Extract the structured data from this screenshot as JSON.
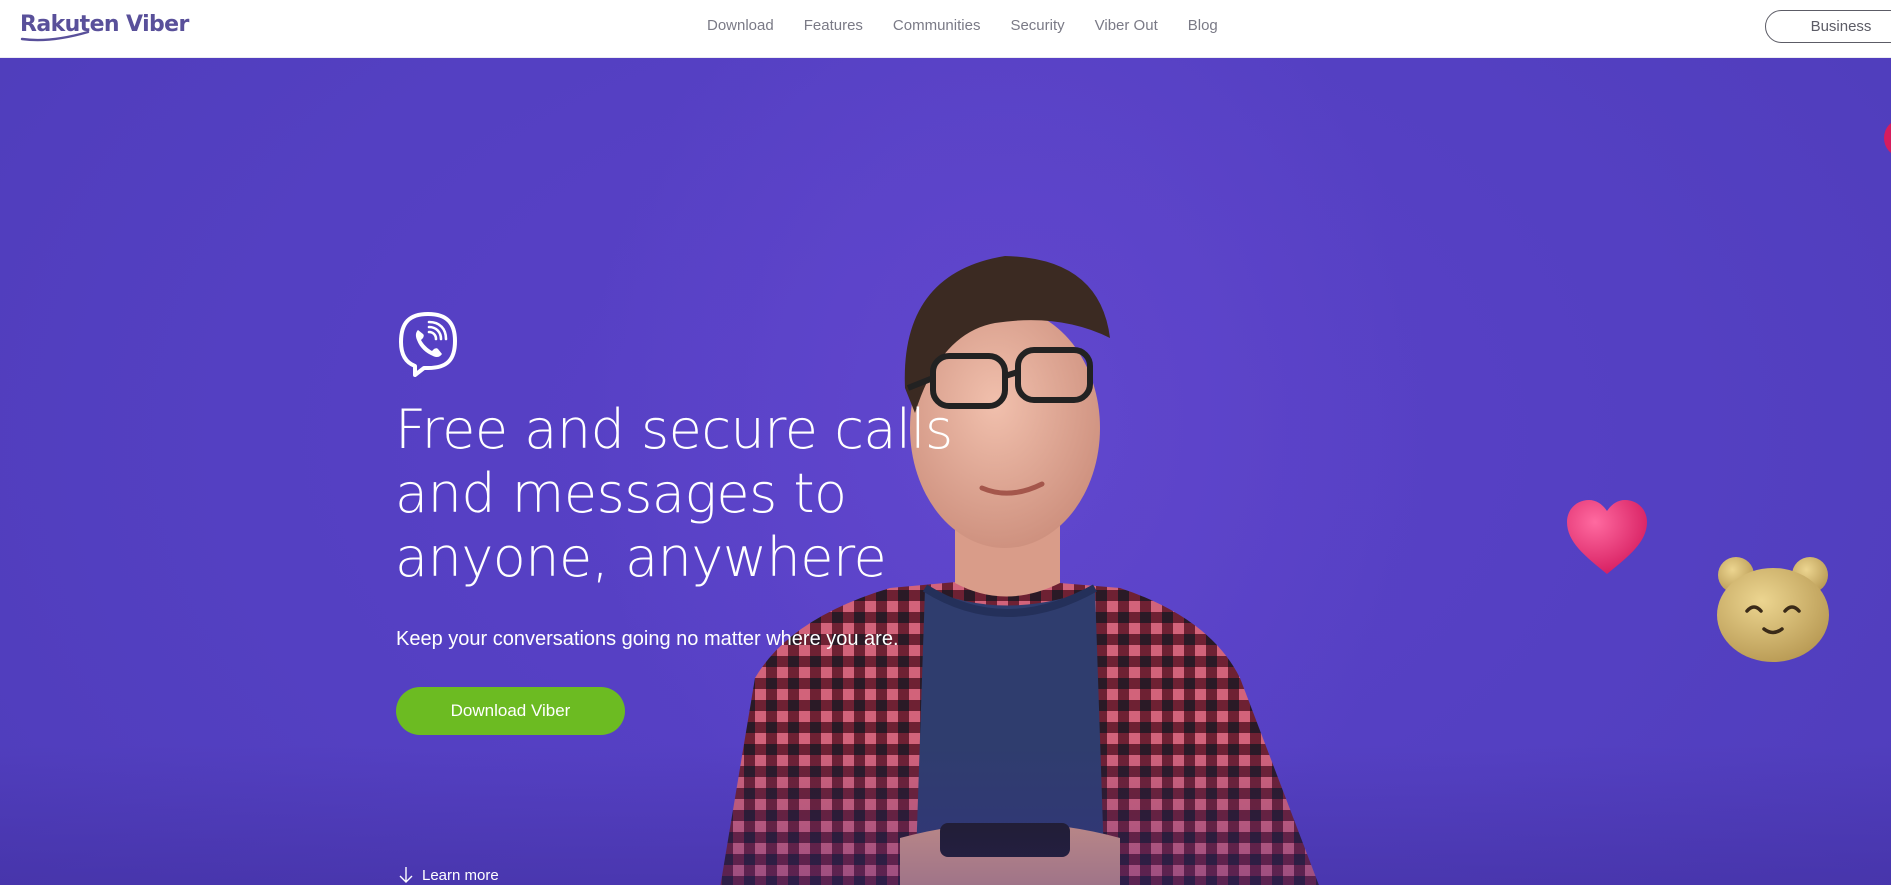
{
  "brand": {
    "logo_text": "Rakuten Viber"
  },
  "nav": {
    "items": [
      {
        "label": "Download"
      },
      {
        "label": "Features"
      },
      {
        "label": "Communities"
      },
      {
        "label": "Security"
      },
      {
        "label": "Viber Out"
      },
      {
        "label": "Blog"
      }
    ],
    "business_label": "Business"
  },
  "hero": {
    "headline_lines": [
      "Free and secure calls",
      "and messages to",
      "anyone, anywhere"
    ],
    "subline": "Keep your conversations going no matter where you are.",
    "cta_label": "Download Viber",
    "learn_more_label": "Learn more"
  },
  "colors": {
    "brand_purple": "#59509a",
    "hero_purple": "#5440c2",
    "cta_green": "#6cbb22"
  },
  "icons": [
    "viber-logo-icon",
    "arrow-down-icon",
    "heart-emoji",
    "bear-emoji"
  ]
}
